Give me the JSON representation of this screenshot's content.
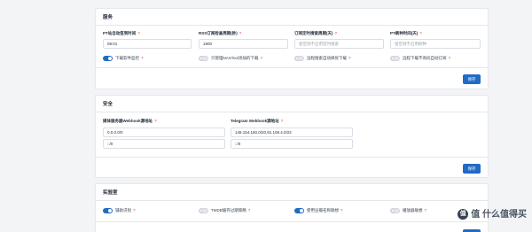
{
  "service": {
    "title": "服务",
    "fields": [
      {
        "label": "PT站自动签到时间",
        "value": "08:01",
        "placeholder": ""
      },
      {
        "label": "RSS订阅检查周期(秒)",
        "value": "1800",
        "placeholder": ""
      },
      {
        "label": "订阅定时搜索周期(天)",
        "value": "",
        "placeholder": "留空则不启用定时搜索"
      },
      {
        "label": "PT刷种时间(天)",
        "value": "",
        "placeholder": "留空则不启用刷种"
      }
    ],
    "toggles": [
      {
        "label": "下载软件监控",
        "on": true
      },
      {
        "label": "只管理NASTool添加的下载",
        "on": false
      },
      {
        "label": "远程搜索自动择优下载",
        "on": false
      },
      {
        "label": "远程下载不询问自动订阅",
        "on": false
      }
    ],
    "save_label": "保存"
  },
  "security": {
    "title": "安全",
    "media_label": "媒体服务器Webhook源地址",
    "media_value": "0.0.0.0/0",
    "media_ipv6": "::/0",
    "tg_label": "Telegram Webhook源地址",
    "tg_value": "149.154.160.0/20,91.108.4.0/22",
    "tg_ipv6": "::/0",
    "save_label": "保存"
  },
  "lab": {
    "title": "实验室",
    "toggles": [
      {
        "label": "辅助识别",
        "on": true
      },
      {
        "label": "TMDB缓存过期策略",
        "on": false
      },
      {
        "label": "使用豆瓣名称联想",
        "on": true
      },
      {
        "label": "播放器联想",
        "on": false
      }
    ],
    "save_label": "保存"
  },
  "help_mark": "?",
  "watermark": "值 什么值得买"
}
